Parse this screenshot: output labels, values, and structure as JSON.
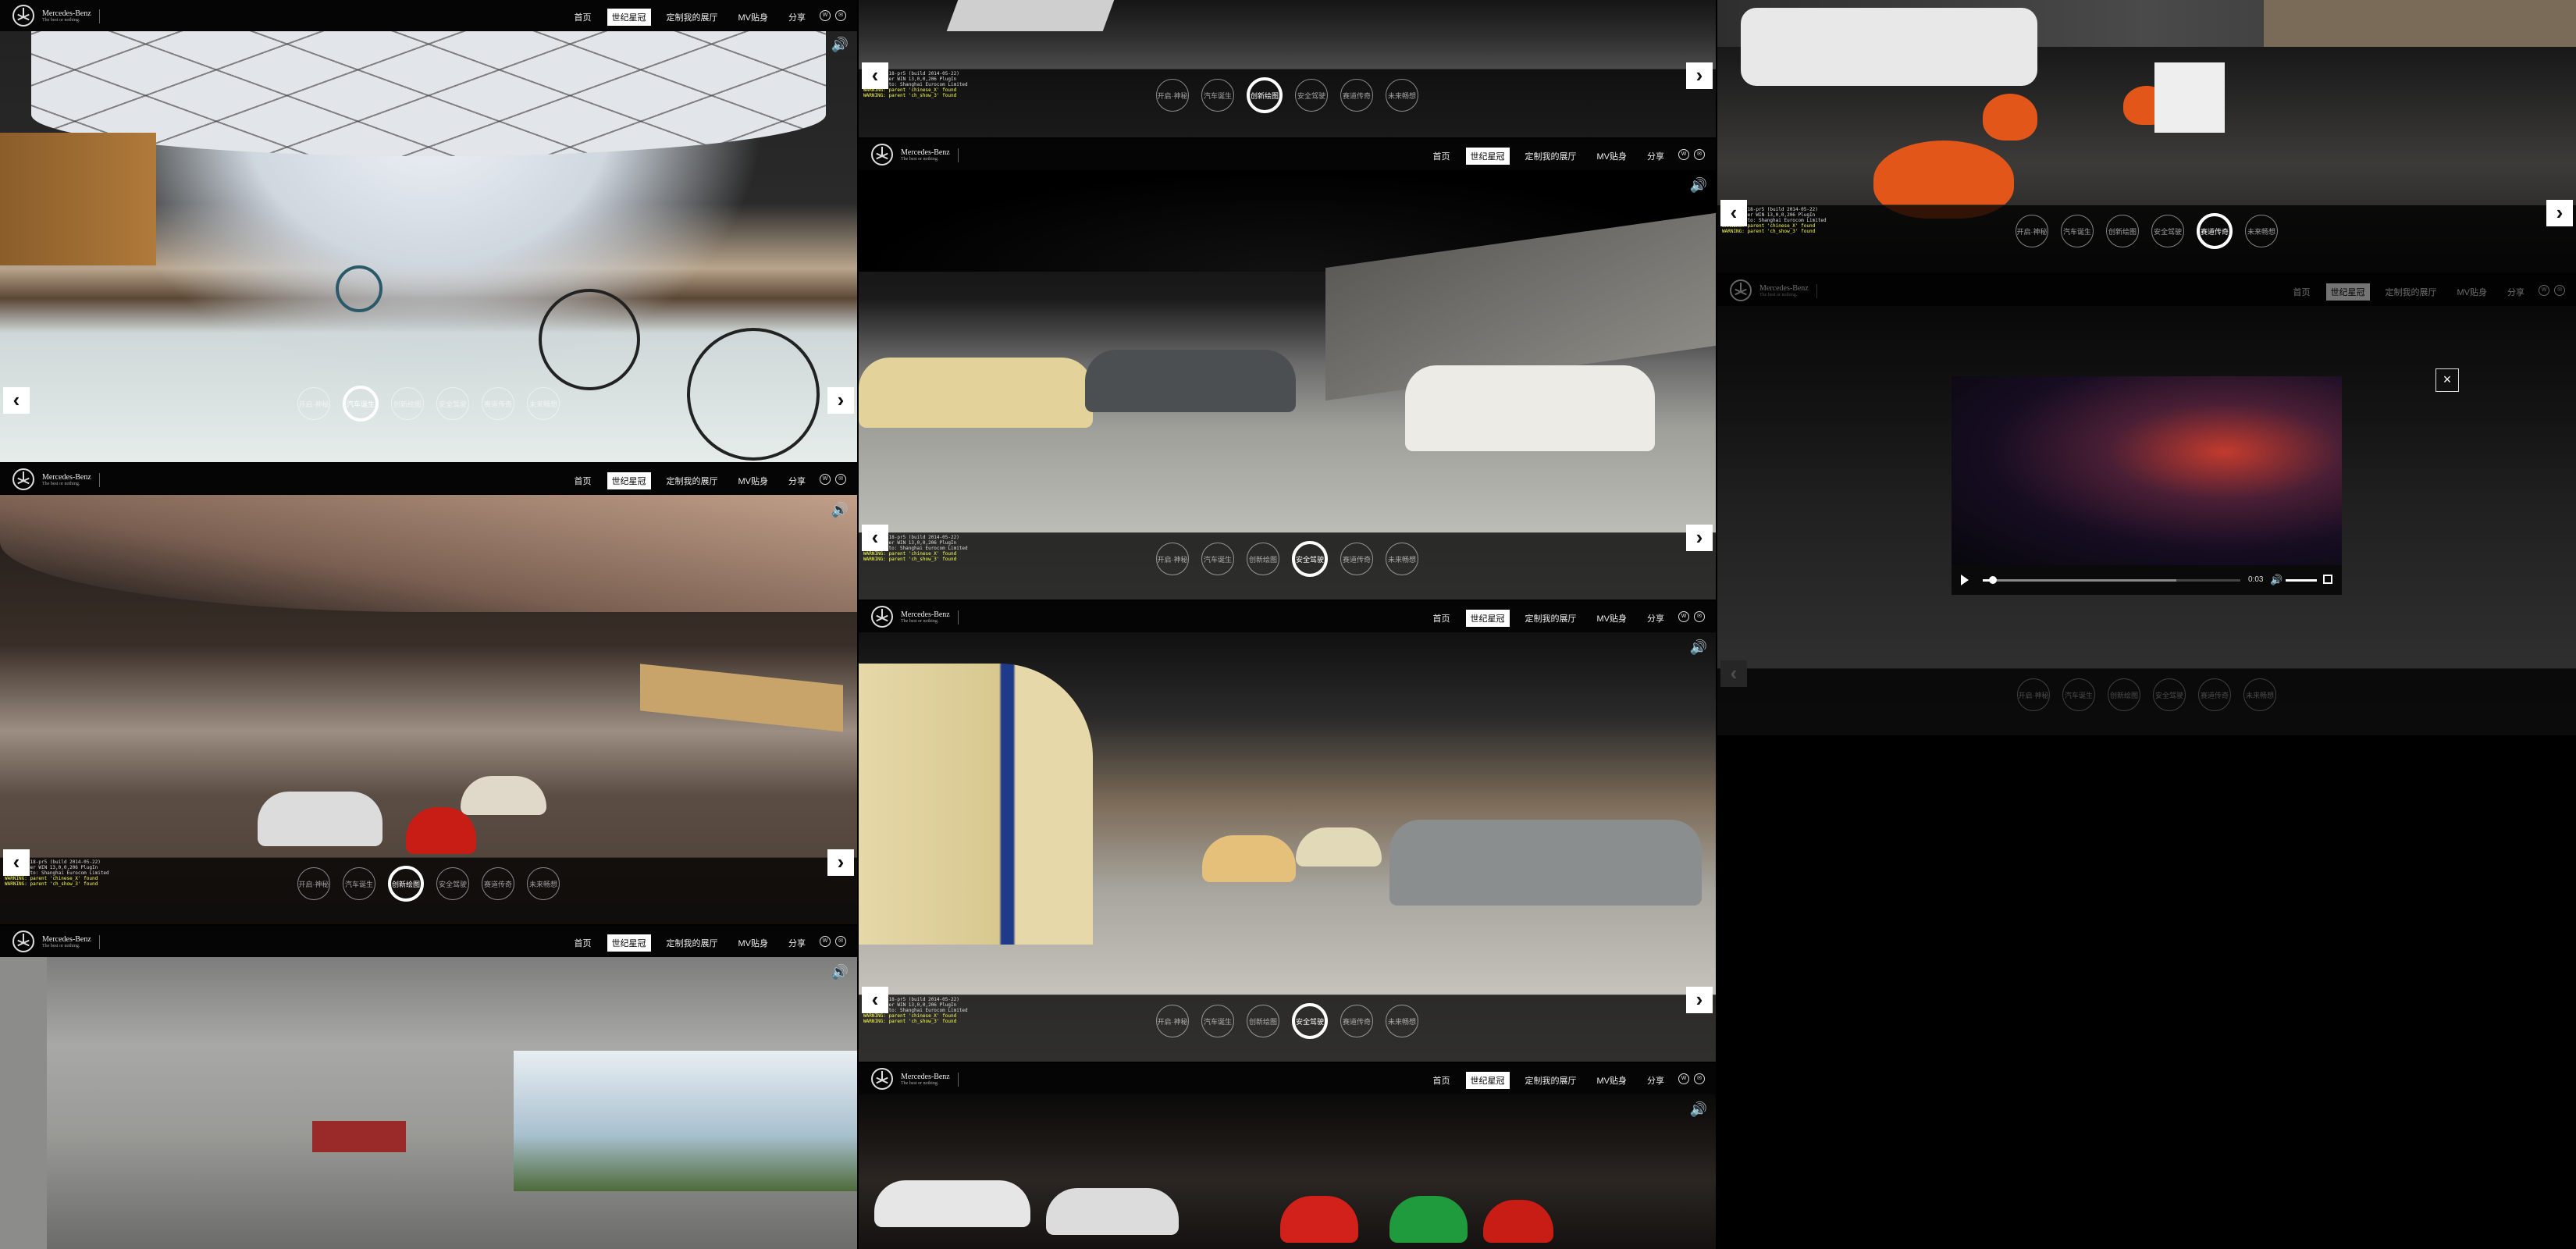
{
  "brand": {
    "name": "Mercedes-Benz",
    "tagline": "The best or nothing."
  },
  "nav": {
    "home": "首页",
    "century": "世纪星冠",
    "future": "定制我的展厅",
    "mv": "MV贴身",
    "share": "分享"
  },
  "icons": {
    "weibo": "weibo-icon",
    "wechat": "wechat-icon",
    "sound": "speaker-icon",
    "prev": "chevron-left-icon",
    "next": "chevron-right-icon",
    "close": "close-icon"
  },
  "dots": [
    "开启·神秘",
    "汽车诞生",
    "创新绘图",
    "安全驾驶",
    "赛道传奇",
    "未来畅想"
  ],
  "console": {
    "line1": "krpano 1.18-pr5 (build 2014-05-22)",
    "line2": "Flashplayer WIN 13,0,0,206 PlugIn",
    "line3": "licensed to: Shanghai Eurocom Limited",
    "line4": "WARNING: parent 'chinese_X' found",
    "line5": "WARNING: parent 'ch_show_3' found"
  },
  "video": {
    "time": "0:03",
    "progress": 0.04,
    "buffered": 0.75
  },
  "panels": [
    {
      "id": "p1",
      "active_dot": 1
    },
    {
      "id": "p2",
      "active_dot": 2
    },
    {
      "id": "p3",
      "active_dot": 4
    },
    {
      "id": "p4",
      "active_dot": 3
    },
    {
      "id": "p5",
      "active_dot": 2
    },
    {
      "id": "p6",
      "active_dot": 3
    }
  ]
}
